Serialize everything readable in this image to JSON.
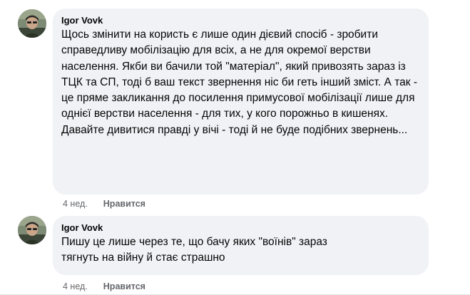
{
  "comments": [
    {
      "author": "Igor Vovk",
      "text": "Щось змінити на користь є лише один дієвий спосіб - зробити справедливу мобілізацію для всіх, а не для окремої верстви населення. Якби ви бачили той \"матеріал\", який привозять зараз із ТЦК та СП, тоді б ваш текст звернення ніс би геть інший зміст. А так - це пряме закликання до посилення примусової мобілізації лише для однієї верстви населення - для тих, у кого порожньо в кишенях. Давайте дивитися правді у вічі - тоді й не буде подібних звернень...",
      "time": "4 нед.",
      "like_label": "Нравится"
    },
    {
      "author": "Igor Vovk",
      "text": "Пишу це лише через те, що бачу яких \"воїнів\" зараз тягнуть на війну й стає страшно",
      "time": "4 нед.",
      "like_label": "Нравится"
    }
  ],
  "colors": {
    "bubble_bg": "#f0f2f5",
    "meta_text": "#65676b",
    "main_text": "#050505"
  },
  "icons": {
    "avatar": "user-avatar-photo"
  }
}
